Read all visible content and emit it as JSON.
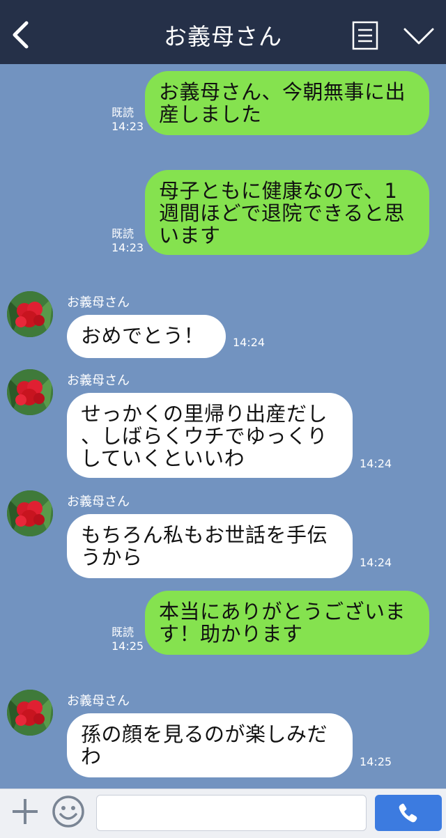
{
  "header": {
    "title": "お義母さん",
    "back_icon": "chevron-left-icon",
    "menu_icon": "menu-icon",
    "dropdown_icon": "chevron-down-icon"
  },
  "messages": [
    {
      "side": "out",
      "read": "既読",
      "time": "14:23",
      "lines": [
        "お義母さん、今朝無事に出",
        "産しました"
      ]
    },
    {
      "side": "out",
      "read": "既読",
      "time": "14:23",
      "lines": [
        "母子ともに健康なので、1",
        "週間ほどで退院できると思",
        "います"
      ]
    },
    {
      "side": "in",
      "sender": "お義母さん",
      "time": "14:24",
      "lines": [
        "おめでとう！"
      ]
    },
    {
      "side": "in",
      "sender": "お義母さん",
      "time": "14:24",
      "lines": [
        "せっかくの里帰り出産だし",
        "、しばらくウチでゆっくり",
        "していくといいわ"
      ]
    },
    {
      "side": "in",
      "sender": "お義母さん",
      "time": "14:24",
      "lines": [
        "もちろん私もお世話を手伝",
        "うから"
      ]
    },
    {
      "side": "out",
      "read": "既読",
      "time": "14:25",
      "lines": [
        "本当にありがとうございま",
        "す！助かります"
      ]
    },
    {
      "side": "in",
      "sender": "お義母さん",
      "time": "14:25",
      "lines": [
        "孫の顔を見るのが楽しみだ",
        "わ"
      ]
    }
  ],
  "input_bar": {
    "plus_icon": "plus-icon",
    "emoji_icon": "smiley-icon",
    "input_value": "",
    "call_icon": "phone-icon"
  },
  "colors": {
    "background": "#7293c0",
    "header": "#253048",
    "outgoing_bubble": "#85e24f",
    "incoming_bubble": "#ffffff",
    "call_button": "#3c7be0"
  }
}
